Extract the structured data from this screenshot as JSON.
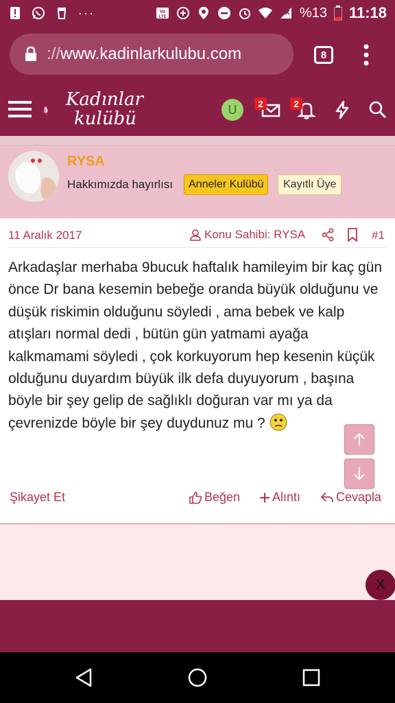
{
  "status_bar": {
    "battery_percent": "%13",
    "time": "11:18",
    "icons": [
      "alert-icon",
      "whatsapp-icon",
      "trash-icon",
      "more-icon",
      "volte-icon",
      "data-saver-icon",
      "location-icon",
      "dnd-icon",
      "alarm-icon",
      "wifi-icon",
      "signal-icon",
      "battery-icon"
    ]
  },
  "browser": {
    "url_protocol": "://",
    "url_host": "www.kadinlarkulubu.com",
    "tab_count": "8"
  },
  "site_header": {
    "logo_line1": "Kadınlar",
    "logo_line2": "kulübü",
    "user_initial": "U",
    "messages_badge": "2",
    "alerts_badge": "2"
  },
  "author": {
    "name": "RYSA",
    "title": "Hakkımızda hayırlısı",
    "tag_primary": "Anneler Kulübü",
    "tag_secondary": "Kayıtlı Üye"
  },
  "post": {
    "date": "11 Aralık 2017",
    "owner_label": "Konu Sahibi: RYSA",
    "post_number": "#1",
    "body": "Arkadaşlar merhaba 9bucuk haftalık hamileyim bir kaç gün önce Dr bana kesemin bebeğe oranda büyük olduğunu ve düşük riskimin olduğunu söyledi , ama bebek ve kalp atışları normal dedi , bütün gün yatmami ayağa kalkmamami söyledi , çok korkuyorum hep kesenin küçük olduğunu duyardım büyük ilk defa duyuyorum , başına böyle bir şey gelip de sağlıklı doğuran var mı ya da çevrenizde böyle bir şey duydunuz mu ?"
  },
  "actions": {
    "report": "Şikayet Et",
    "like": "Beğen",
    "quote": "Alıntı",
    "reply": "Cevapla"
  },
  "overlay": {
    "close_label": "X"
  },
  "colors": {
    "brand": "#8a1f45",
    "accent_text": "#b8334c",
    "author_name": "#f39b1c",
    "author_bg": "#ebc0ca"
  }
}
